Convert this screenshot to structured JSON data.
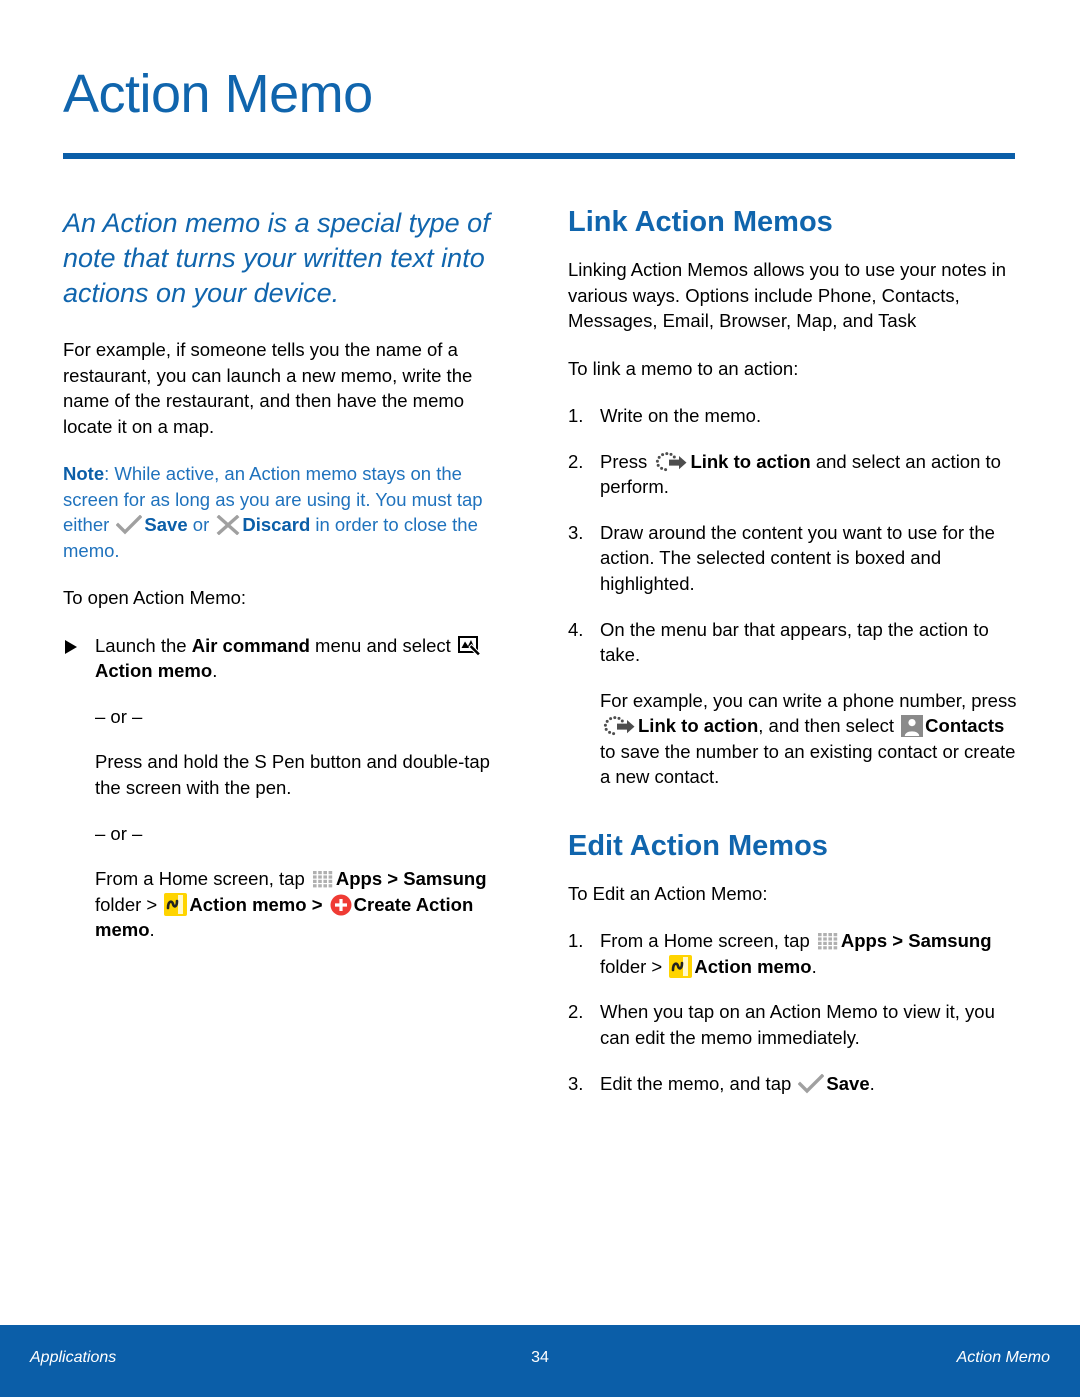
{
  "page": {
    "title": "Action Memo",
    "accent_blue": "#1065ad",
    "rule_blue": "#0b5ea8",
    "note_blue": "#1f72bd"
  },
  "left_column": {
    "lead": "An Action memo is a special type of note that turns your written text into actions on your device.",
    "example_paragraph": "For example, if someone tells you the name of a restaurant, you can launch a new memo, write the name of the restaurant, and then have the memo locate it on a map.",
    "note": {
      "label": "Note",
      "part1": ": While active, an Action memo stays on the screen for as long as you are using it. You must tap either ",
      "save_label": "Save",
      "part2": " or ",
      "discard_label": "Discard",
      "part3": " in order to close the memo."
    },
    "open_intro": "To open Action Memo:",
    "bullet": {
      "part1": "Launch the ",
      "bold1": "Air command",
      "part2": " menu and select ",
      "bold2": "Action memo",
      "part3": "."
    },
    "or_1": "– or –",
    "alt1": "Press and hold the S Pen button and double-tap the screen with the pen.",
    "or_2": "– or –",
    "alt2": {
      "part1": "From a Home screen, tap ",
      "apps": "Apps",
      "sep1": " > ",
      "samsung": "Samsung",
      "folder": " folder > ",
      "action_memo": "Action memo",
      "sep2": " > ",
      "create": "Create Action memo",
      "period": "."
    }
  },
  "right_column": {
    "link_heading": "Link Action Memos",
    "link_intro": "Linking Action Memos allows you to use your notes in various ways. Options include Phone, Contacts, Messages, Email, Browser, Map, and Task",
    "link_steps_intro": "To link a memo to an action:",
    "link_steps": [
      {
        "num": "1.",
        "text": "Write on the memo."
      },
      {
        "num": "2.",
        "pre": "Press ",
        "bold": "Link to action",
        "post": " and select an action to perform.",
        "icon": "link-to-action-icon"
      },
      {
        "num": "3.",
        "text": "Draw around the content you want to use for the action. The selected content is boxed and highlighted."
      },
      {
        "num": "4.",
        "text": "On the menu bar that appears, tap the action to take."
      }
    ],
    "link_example": {
      "part1": "For example, you can write a phone number, press ",
      "bold1": "Link to action",
      "part2": ", and then select ",
      "bold2": "Contacts",
      "part3": " to save the number to an existing contact or create a new contact."
    },
    "edit_heading": "Edit Action Memos",
    "edit_steps_intro": "To Edit an Action Memo:",
    "edit_steps": [
      {
        "num": "1.",
        "pre": "From a Home screen, tap ",
        "apps": "Apps",
        "sep1": " > ",
        "samsung": "Samsung",
        "folder": " folder > ",
        "action_memo": "Action memo",
        "period": "."
      },
      {
        "num": "2.",
        "text": "When you tap on an Action Memo to view it, you can edit the memo immediately."
      },
      {
        "num": "3.",
        "pre": "Edit the memo, and tap ",
        "bold": "Save",
        "post": ".",
        "icon": "check-icon"
      }
    ]
  },
  "footer": {
    "left": "Applications",
    "page_number": "34",
    "right": "Action Memo"
  },
  "icons": {
    "check": "check-icon",
    "discard": "x-icon",
    "memo_pen": "memo-pen-icon",
    "apps_grid": "apps-grid-icon",
    "action_memo": "action-memo-icon",
    "create_plus": "plus-circle-icon",
    "link_to_action": "link-to-action-icon",
    "contacts": "contacts-icon"
  }
}
